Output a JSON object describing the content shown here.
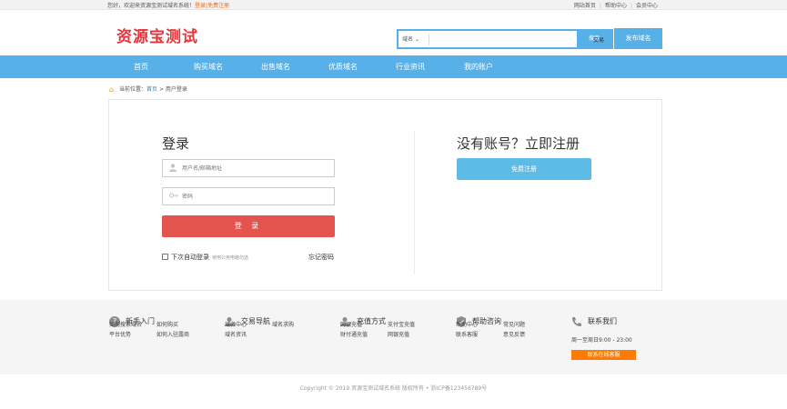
{
  "topbar": {
    "welcome": "您好，欢迎来资源宝测试域名系统！",
    "login": "登录",
    "sep": "|",
    "register": "免费注册",
    "right_links": [
      "网站首页",
      "帮助中心",
      "会员中心"
    ]
  },
  "header": {
    "logo": "资源宝测试",
    "search_select": "域名",
    "search_placeholder": "",
    "search_button": "搜索",
    "trade_link": "交易",
    "publish_button": "发布域名"
  },
  "nav": {
    "items": [
      "首页",
      "购买域名",
      "出售域名",
      "优质域名",
      "行业资讯",
      "我的账户"
    ]
  },
  "breadcrumb": {
    "prefix": "当前位置：",
    "home": "首页",
    "sep": " > ",
    "current": "用户登录"
  },
  "login": {
    "title": "登录",
    "username_placeholder": "用户名/邮箱地址",
    "password_placeholder": "密码",
    "submit": "登 录",
    "remember": "下次自动登录",
    "remember_hint": "使用公用电脑勿选",
    "forgot": "忘记密码"
  },
  "register": {
    "title": "没有账号？立即注册",
    "button": "免费注册"
  },
  "footer": {
    "columns": [
      {
        "title": "新手入门",
        "icon": "question-icon",
        "links": [
          [
            "如何搜索域名",
            "如何购买"
          ],
          [
            "平台优势",
            "如何入驻露商"
          ]
        ]
      },
      {
        "title": "交易导航",
        "icon": "user-nav-icon",
        "links": [
          [
            "域名中心",
            "域名求购"
          ],
          [
            "域名资讯"
          ]
        ]
      },
      {
        "title": "充值方式",
        "icon": "user-pay-icon",
        "links": [
          [
            "网银充值",
            "支付宝充值"
          ],
          [
            "财付通充值",
            "网银充值"
          ]
        ]
      },
      {
        "title": "帮助咨询",
        "icon": "shield-icon",
        "links": [
          [
            "帮助中心",
            "常见问题"
          ],
          [
            "联系客服",
            "意见反馈"
          ]
        ]
      },
      {
        "title": "联系我们",
        "icon": "phone-icon",
        "hours": "周一至周日9:00 - 23:00",
        "service_button": "联系在线客服"
      }
    ]
  },
  "copyright": "Copyright © 2019 资源宝测试域名系统 版权所有 • 浙ICP备123456789号",
  "colors": {
    "accent": "#58b0e8",
    "logo": "#e6343a",
    "login_button": "#e4544f",
    "register_button": "#5cbce6",
    "service_button": "#ff7a00"
  }
}
